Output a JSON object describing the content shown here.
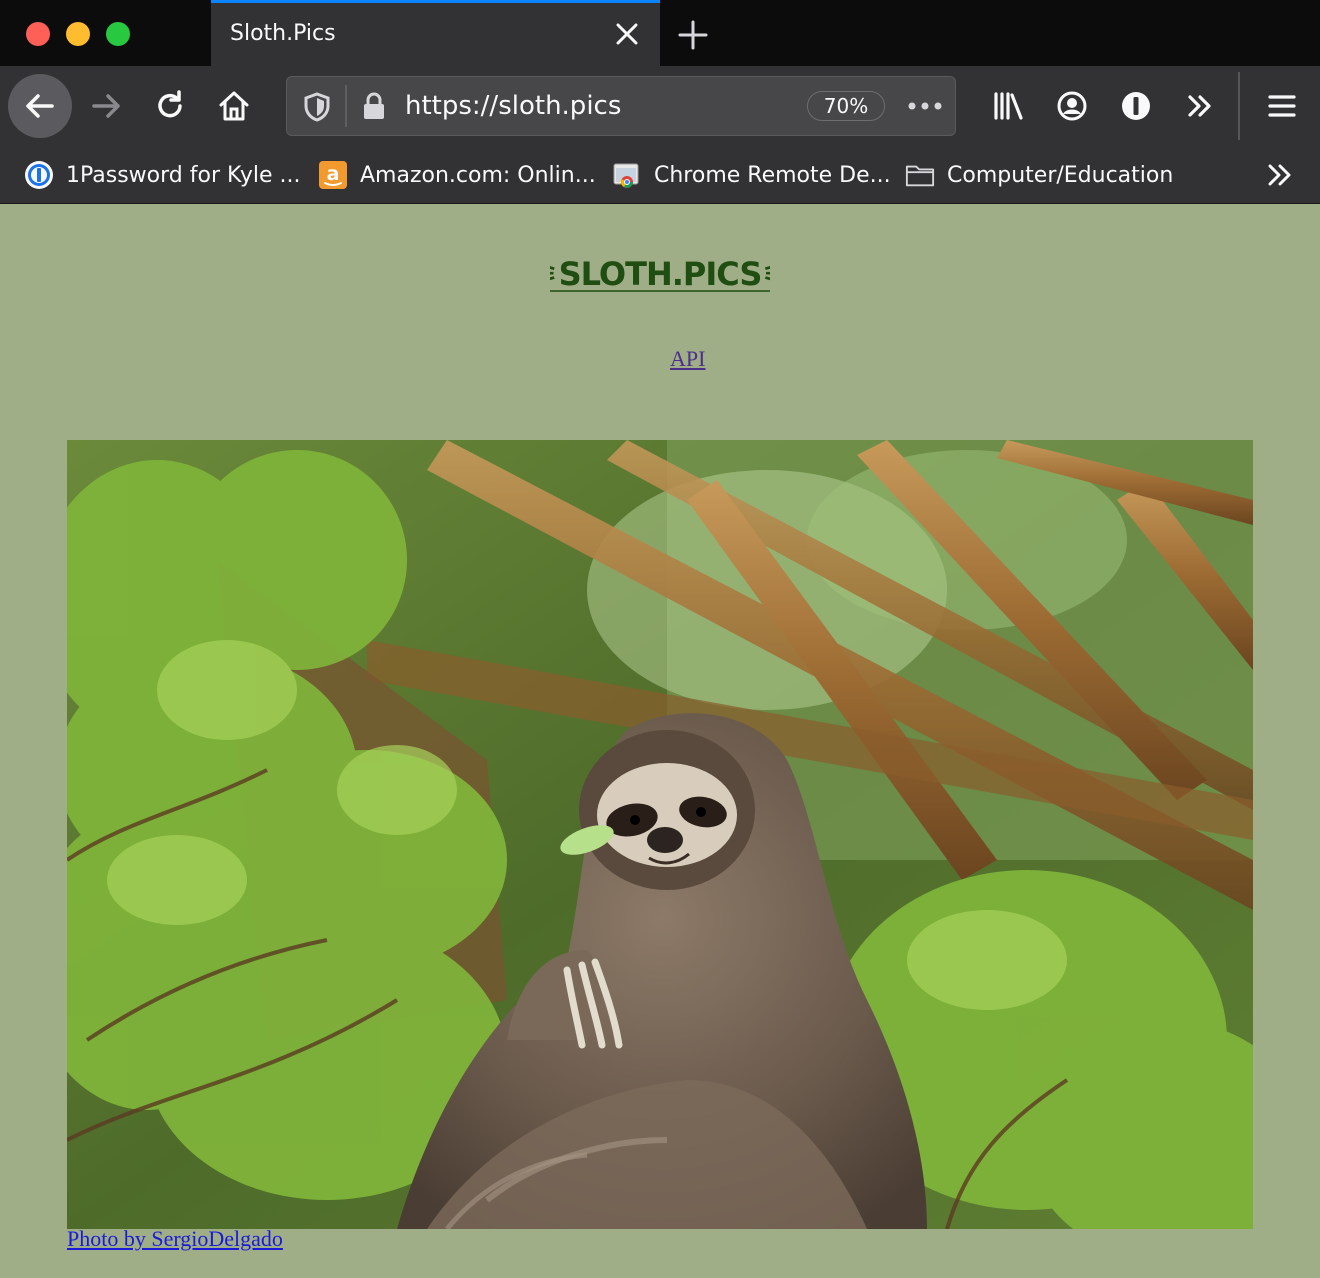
{
  "window": {
    "traffic_lights": [
      "close",
      "minimize",
      "zoom"
    ]
  },
  "tab": {
    "title": "Sloth.Pics"
  },
  "toolbar": {
    "url": "https://sloth.pics",
    "zoom": "70%"
  },
  "bookmarks": [
    {
      "label": "1Password for Kyle ...",
      "icon": "onepassword-icon"
    },
    {
      "label": "Amazon.com: Onlin...",
      "icon": "amazon-icon"
    },
    {
      "label": "Chrome Remote De...",
      "icon": "chrome-remote-icon"
    },
    {
      "label": "Computer/Education",
      "icon": "folder-icon"
    }
  ],
  "page": {
    "logo_text": "⚞SLOTH.PICS⚟",
    "api_link": "API",
    "photo_credit": "Photo by SergioDelgado",
    "background_color": "#9fae87",
    "logo_color": "#1f4d12"
  }
}
